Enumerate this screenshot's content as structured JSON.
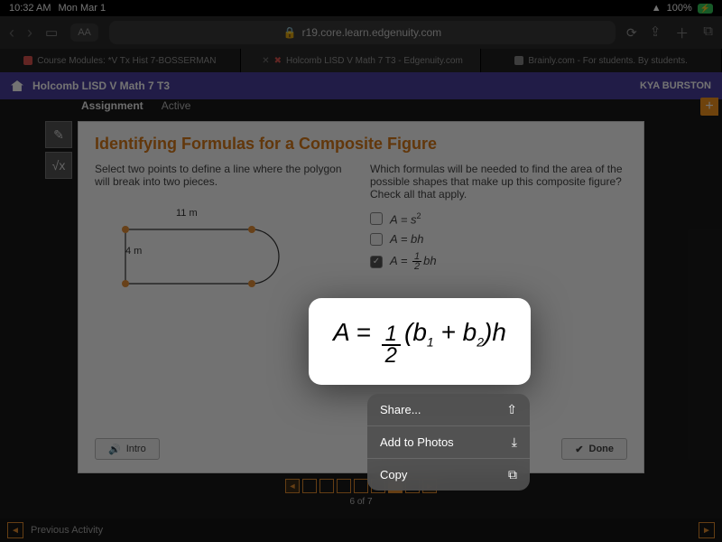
{
  "status": {
    "time": "10:32 AM",
    "date": "Mon Mar 1",
    "battery": "100%"
  },
  "browser": {
    "aa": "AA",
    "lock": "🔒",
    "url": "r19.core.learn.edgenuity.com",
    "tabs": [
      {
        "label": "Course Modules: *V Tx Hist 7-BOSSERMAN"
      },
      {
        "label": "Holcomb LISD V Math 7 T3 - Edgenuity.com"
      },
      {
        "label": "Brainly.com - For students. By students."
      }
    ]
  },
  "course": {
    "title": "Holcomb LISD V Math 7 T3",
    "user": "KYA BURSTON"
  },
  "assignment": {
    "label": "Assignment",
    "status": "Active",
    "plus": "+"
  },
  "lesson": {
    "title": "Identifying Formulas for a Composite Figure",
    "prompt_left": "Select two points to define a line where the polygon will break into two pieces.",
    "prompt_right": "Which formulas will be needed to find the area of the possible shapes that make up this composite figure? Check all that apply.",
    "fig": {
      "top": "11 m",
      "side": "4 m"
    },
    "options": [
      {
        "formula_html": "A = s<span style='font-style:normal;font-size:9px;vertical-align:super'>2</span>",
        "checked": false
      },
      {
        "formula_html": "A = bh",
        "checked": false
      },
      {
        "formula_html": "A = <span class='frac'><span class='n'>1</span><span>2</span></span> bh",
        "checked": true
      }
    ],
    "intro": "Intro",
    "done": "Done"
  },
  "pager": {
    "current": 6,
    "total": 7,
    "label": "6 of 7"
  },
  "footer": {
    "prev": "Previous Activity"
  },
  "popover": {
    "formula": "A = ½(b₁ + b₂)h"
  },
  "context_menu": [
    {
      "label": "Share...",
      "icon": "share-icon"
    },
    {
      "label": "Add to Photos",
      "icon": "download-icon"
    },
    {
      "label": "Copy",
      "icon": "copy-icon"
    }
  ]
}
